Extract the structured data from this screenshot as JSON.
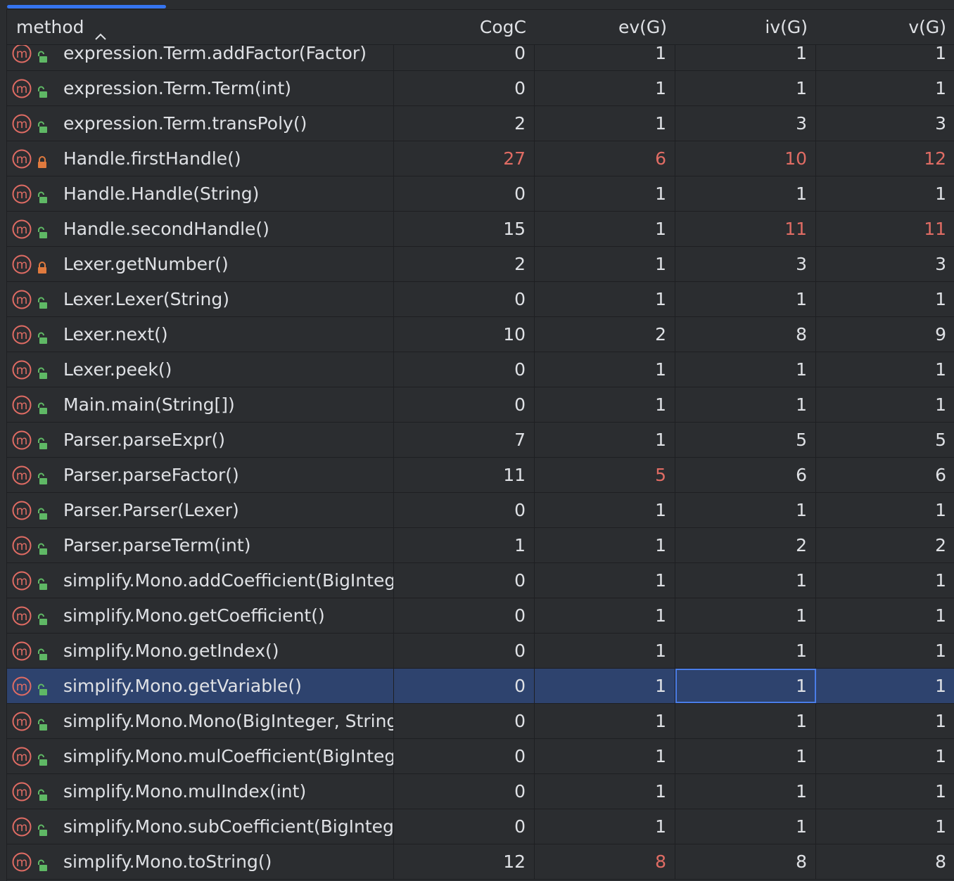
{
  "colors": {
    "background": "#2b2d30",
    "selected_row": "#2e436e",
    "warning_value": "#e06c64",
    "method_icon": "#e06c64",
    "public_lock": "#5fb865",
    "private_lock": "#e07a3e",
    "scroll_indicator": "#3574f0"
  },
  "header": {
    "method": "method",
    "cogc": "CogC",
    "evg": "ev(G)",
    "ivg": "iv(G)",
    "vg": "v(G)",
    "sort_icon": "chevron-up-icon"
  },
  "rows": [
    {
      "method": "expression.Term.addFactor(Factor)",
      "access": "public",
      "cogc": "0",
      "evg": "1",
      "ivg": "1",
      "vg": "1",
      "warn": []
    },
    {
      "method": "expression.Term.Term(int)",
      "access": "public",
      "cogc": "0",
      "evg": "1",
      "ivg": "1",
      "vg": "1",
      "warn": []
    },
    {
      "method": "expression.Term.transPoly()",
      "access": "public",
      "cogc": "2",
      "evg": "1",
      "ivg": "3",
      "vg": "3",
      "warn": []
    },
    {
      "method": "Handle.firstHandle()",
      "access": "private",
      "cogc": "27",
      "evg": "6",
      "ivg": "10",
      "vg": "12",
      "warn": [
        "cogc",
        "evg",
        "ivg",
        "vg"
      ]
    },
    {
      "method": "Handle.Handle(String)",
      "access": "public",
      "cogc": "0",
      "evg": "1",
      "ivg": "1",
      "vg": "1",
      "warn": []
    },
    {
      "method": "Handle.secondHandle()",
      "access": "public",
      "cogc": "15",
      "evg": "1",
      "ivg": "11",
      "vg": "11",
      "warn": [
        "ivg",
        "vg"
      ]
    },
    {
      "method": "Lexer.getNumber()",
      "access": "private",
      "cogc": "2",
      "evg": "1",
      "ivg": "3",
      "vg": "3",
      "warn": []
    },
    {
      "method": "Lexer.Lexer(String)",
      "access": "public",
      "cogc": "0",
      "evg": "1",
      "ivg": "1",
      "vg": "1",
      "warn": []
    },
    {
      "method": "Lexer.next()",
      "access": "public",
      "cogc": "10",
      "evg": "2",
      "ivg": "8",
      "vg": "9",
      "warn": []
    },
    {
      "method": "Lexer.peek()",
      "access": "public",
      "cogc": "0",
      "evg": "1",
      "ivg": "1",
      "vg": "1",
      "warn": []
    },
    {
      "method": "Main.main(String[])",
      "access": "public",
      "cogc": "0",
      "evg": "1",
      "ivg": "1",
      "vg": "1",
      "warn": []
    },
    {
      "method": "Parser.parseExpr()",
      "access": "public",
      "cogc": "7",
      "evg": "1",
      "ivg": "5",
      "vg": "5",
      "warn": []
    },
    {
      "method": "Parser.parseFactor()",
      "access": "public",
      "cogc": "11",
      "evg": "5",
      "ivg": "6",
      "vg": "6",
      "warn": [
        "evg"
      ]
    },
    {
      "method": "Parser.Parser(Lexer)",
      "access": "public",
      "cogc": "0",
      "evg": "1",
      "ivg": "1",
      "vg": "1",
      "warn": []
    },
    {
      "method": "Parser.parseTerm(int)",
      "access": "public",
      "cogc": "1",
      "evg": "1",
      "ivg": "2",
      "vg": "2",
      "warn": []
    },
    {
      "method": "simplify.Mono.addCoefficient(BigInteg",
      "access": "public",
      "cogc": "0",
      "evg": "1",
      "ivg": "1",
      "vg": "1",
      "warn": []
    },
    {
      "method": "simplify.Mono.getCoefficient()",
      "access": "public",
      "cogc": "0",
      "evg": "1",
      "ivg": "1",
      "vg": "1",
      "warn": []
    },
    {
      "method": "simplify.Mono.getIndex()",
      "access": "public",
      "cogc": "0",
      "evg": "1",
      "ivg": "1",
      "vg": "1",
      "warn": []
    },
    {
      "method": "simplify.Mono.getVariable()",
      "access": "public",
      "cogc": "0",
      "evg": "1",
      "ivg": "1",
      "vg": "1",
      "warn": [],
      "selected": true,
      "focused_column": "ivg"
    },
    {
      "method": "simplify.Mono.Mono(BigInteger, String",
      "access": "public",
      "cogc": "0",
      "evg": "1",
      "ivg": "1",
      "vg": "1",
      "warn": []
    },
    {
      "method": "simplify.Mono.mulCoefficient(BigInteg",
      "access": "public",
      "cogc": "0",
      "evg": "1",
      "ivg": "1",
      "vg": "1",
      "warn": []
    },
    {
      "method": "simplify.Mono.mulIndex(int)",
      "access": "public",
      "cogc": "0",
      "evg": "1",
      "ivg": "1",
      "vg": "1",
      "warn": []
    },
    {
      "method": "simplify.Mono.subCoefficient(BigInteg",
      "access": "public",
      "cogc": "0",
      "evg": "1",
      "ivg": "1",
      "vg": "1",
      "warn": []
    },
    {
      "method": "simplify.Mono.toString()",
      "access": "public",
      "cogc": "12",
      "evg": "8",
      "ivg": "8",
      "vg": "8",
      "warn": [
        "evg"
      ]
    }
  ]
}
